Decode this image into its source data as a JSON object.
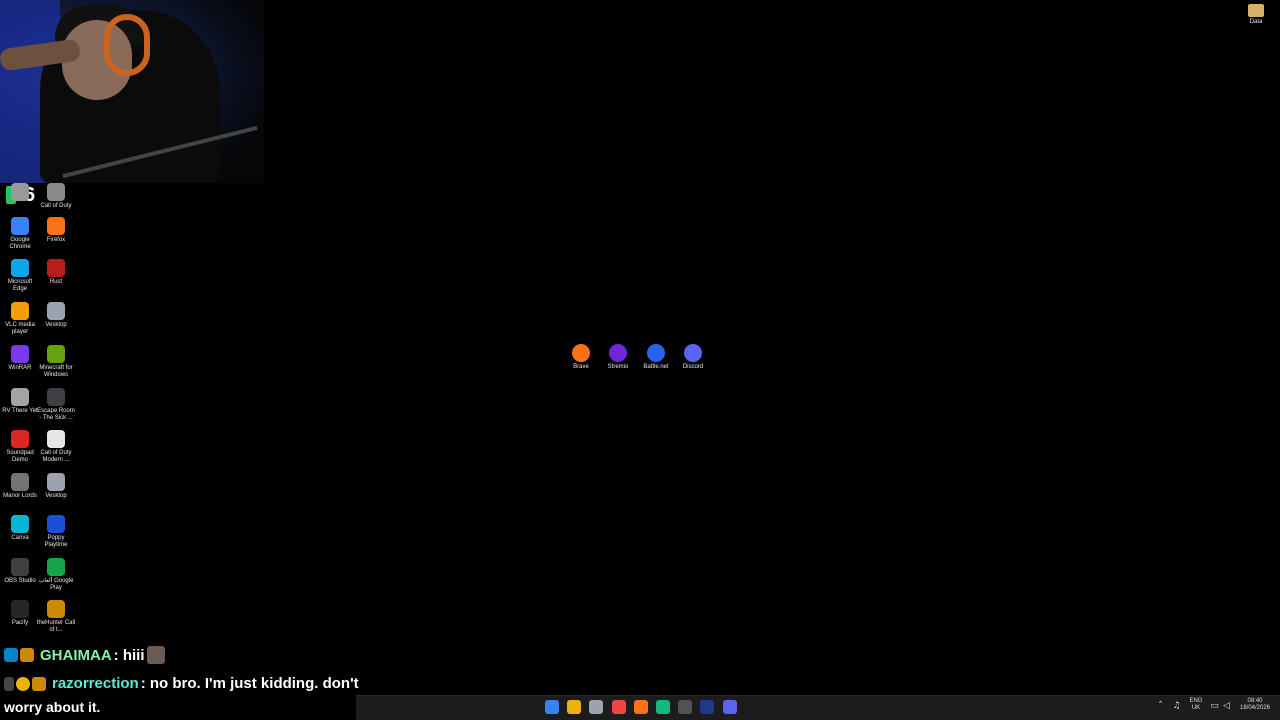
{
  "stream": {
    "viewer_count": "6"
  },
  "desktop": {
    "left_icons": [
      {
        "label": "",
        "color": "#9a9a9a"
      },
      {
        "label": "Call of Duty",
        "color": "#8a8a8a"
      },
      {
        "label": "Google Chrome",
        "color": "#3b82f6"
      },
      {
        "label": "Firefox",
        "color": "#f97316"
      },
      {
        "label": "Microsoft Edge",
        "color": "#0ea5e9"
      },
      {
        "label": "Rust",
        "color": "#b91c1c"
      },
      {
        "label": "VLC media player",
        "color": "#f59e0b"
      },
      {
        "label": "Vesktop",
        "color": "#9ca3af"
      },
      {
        "label": "WinRAR",
        "color": "#7c3aed"
      },
      {
        "label": "Minecraft for Windows",
        "color": "#65a30d"
      },
      {
        "label": "RV There Yet",
        "color": "#a3a3a3"
      },
      {
        "label": "Escape Room - The Sick ...",
        "color": "#3f3f46"
      },
      {
        "label": "Soundpad Demo",
        "color": "#dc2626"
      },
      {
        "label": "Call of Duty Modern ...",
        "color": "#e5e5e5"
      },
      {
        "label": "Manor Lords",
        "color": "#737373"
      },
      {
        "label": "Vesktop",
        "color": "#9ca3af"
      },
      {
        "label": "Canva",
        "color": "#06b6d4"
      },
      {
        "label": "Poppy Playtime",
        "color": "#1d4ed8"
      },
      {
        "label": "OBS Studio",
        "color": "#404040"
      },
      {
        "label": "ألعاب Google Play",
        "color": "#16a34a"
      },
      {
        "label": "Pacify",
        "color": "#292524"
      },
      {
        "label": "theHunter Call of t...",
        "color": "#ca8a04"
      }
    ],
    "center_icons": [
      {
        "label": "Brave",
        "color": "#f97316"
      },
      {
        "label": "Stremio",
        "color": "#6d28d9"
      },
      {
        "label": "Battle.net",
        "color": "#2563eb"
      },
      {
        "label": "Discord",
        "color": "#5865f2"
      }
    ],
    "data_folder": {
      "label": "Data",
      "color": "#d4b06a"
    }
  },
  "chat": [
    {
      "username": "GHAIMAA",
      "message": ": hiii",
      "name_color": "#86efac"
    },
    {
      "username": "razorrection",
      "message": ": no bro. I'm just kidding. don't",
      "name_color": "#5eead4"
    }
  ],
  "chat_continuation": "worry about it.",
  "taskbar": {
    "apps": [
      {
        "name": "start-button",
        "color": "#3b82f6"
      },
      {
        "name": "file-explorer",
        "color": "#eab308"
      },
      {
        "name": "microsoft-store",
        "color": "#9ca3af"
      },
      {
        "name": "chrome",
        "color": "#ef4444"
      },
      {
        "name": "brave",
        "color": "#f97316"
      },
      {
        "name": "app",
        "color": "#10b981"
      },
      {
        "name": "obs",
        "color": "#525252"
      },
      {
        "name": "steam",
        "color": "#1e3a8a"
      },
      {
        "name": "discord",
        "color": "#5865f2"
      }
    ],
    "language": "ENG",
    "region": "UK",
    "time": "08:40",
    "date": "18/04/2026"
  }
}
